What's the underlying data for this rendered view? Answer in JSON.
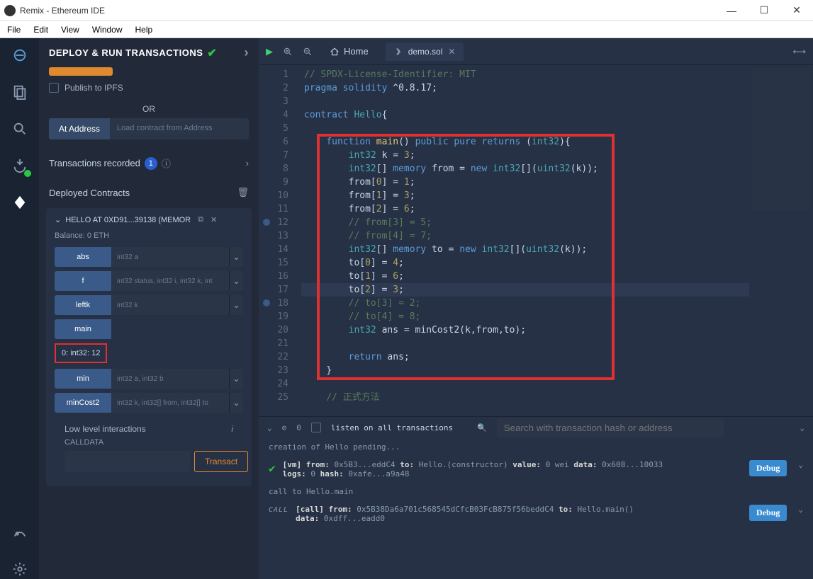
{
  "window": {
    "title": "Remix - Ethereum IDE"
  },
  "menubar": [
    "File",
    "Edit",
    "View",
    "Window",
    "Help"
  ],
  "panel": {
    "title": "DEPLOY & RUN TRANSACTIONS",
    "publish_label": "Publish to IPFS",
    "or": "OR",
    "at_address": "At Address",
    "addr_placeholder": "Load contract from Address",
    "tx_recorded": "Transactions recorded",
    "tx_count": "1",
    "deployed_label": "Deployed Contracts",
    "contract_name": "HELLO AT 0XD91...39138 (MEMOR",
    "balance": "Balance: 0 ETH",
    "functions": [
      {
        "name": "abs",
        "ph": "int32 a"
      },
      {
        "name": "f",
        "ph": "int32 status, int32 i, int32 k, int"
      },
      {
        "name": "leftk",
        "ph": "int32 k"
      },
      {
        "name": "main",
        "ph": ""
      },
      {
        "name": "min",
        "ph": "int32 a, int32 b"
      },
      {
        "name": "minCost2",
        "ph": "int32 k, int32[] from, int32[] to"
      }
    ],
    "main_result": "0: int32: 12",
    "low_level": "Low level interactions",
    "calldata": "CALLDATA",
    "transact": "Transact"
  },
  "tabs": {
    "home": "Home",
    "file": "demo.sol"
  },
  "code_lines": [
    {
      "n": 1,
      "html": "<span class='cm'>// SPDX-License-Identifier: MIT</span>"
    },
    {
      "n": 2,
      "html": "<span class='kw'>pragma</span> <span class='kw'>solidity</span> <span class='op'>^0.8.17;</span>"
    },
    {
      "n": 3,
      "html": ""
    },
    {
      "n": 4,
      "html": "<span class='kw'>contract</span> <span class='ty'>Hello</span>{"
    },
    {
      "n": 5,
      "html": ""
    },
    {
      "n": 6,
      "html": "    <span class='kw'>function</span> <span class='fn'>main</span>() <span class='kw'>public</span> <span class='kw'>pure</span> <span class='kw'>returns</span> (<span class='ty'>int32</span>){"
    },
    {
      "n": 7,
      "html": "        <span class='ty'>int32</span> k = <span class='nm'>3</span>;"
    },
    {
      "n": 8,
      "html": "        <span class='ty'>int32</span>[] <span class='kw'>memory</span> from = <span class='kw'>new</span> <span class='ty'>int32</span>[](<span class='ty'>uint32</span>(k));"
    },
    {
      "n": 9,
      "html": "        from[<span class='nm'>0</span>] = <span class='nm'>1</span>;"
    },
    {
      "n": 10,
      "html": "        from[<span class='nm'>1</span>] = <span class='nm'>3</span>;"
    },
    {
      "n": 11,
      "html": "        from[<span class='nm'>2</span>] = <span class='nm'>6</span>;"
    },
    {
      "n": 12,
      "html": "        <span class='cm'>// from[3] = 5;</span>",
      "bp": true
    },
    {
      "n": 13,
      "html": "        <span class='cm'>// from[4] = 7;</span>"
    },
    {
      "n": 14,
      "html": "        <span class='ty'>int32</span>[] <span class='kw'>memory</span> to = <span class='kw'>new</span> <span class='ty'>int32</span>[](<span class='ty'>uint32</span>(k));"
    },
    {
      "n": 15,
      "html": "        to[<span class='nm'>0</span>] = <span class='nm'>4</span>;"
    },
    {
      "n": 16,
      "html": "        to[<span class='nm'>1</span>] = <span class='nm'>6</span>;"
    },
    {
      "n": 17,
      "html": "        to[<span class='nm'>2</span>] = <span class='nm'>3</span>;",
      "hl": true
    },
    {
      "n": 18,
      "html": "        <span class='cm'>// to[3] = 2;</span>",
      "bp": true
    },
    {
      "n": 19,
      "html": "        <span class='cm'>// to[4] = 8;</span>"
    },
    {
      "n": 20,
      "html": "        <span class='ty'>int32</span> ans = minCost2(k,from,to);"
    },
    {
      "n": 21,
      "html": ""
    },
    {
      "n": 22,
      "html": "        <span class='kw'>return</span> ans;"
    },
    {
      "n": 23,
      "html": "    }"
    },
    {
      "n": 24,
      "html": ""
    },
    {
      "n": 25,
      "html": "    <span class='cm'>// 正式方法</span>"
    }
  ],
  "terminal": {
    "listen": "listen on all transactions",
    "count": "0",
    "search_ph": "Search with transaction hash or address",
    "line1": "creation of Hello pending...",
    "entry1": {
      "t1": "[vm]",
      "l1": "from:",
      "v1": "0x5B3...eddC4",
      "l2": "to:",
      "v2": "Hello.(constructor)",
      "l3": "value:",
      "v3": "0 wei",
      "l4": "data:",
      "v4": "0x608...10033",
      "l5": "logs:",
      "v5": "0",
      "l6": "hash:",
      "v6": "0xafe...a9a48"
    },
    "line2": "call to Hello.main",
    "entry2": {
      "t1": "[call]",
      "l1": "from:",
      "v1": "0x5B38Da6a701c568545dCfcB03FcB875f56beddC4",
      "l2": "to:",
      "v2": "Hello.main()",
      "l3": "data:",
      "v3": "0xdff...eadd0"
    },
    "debug": "Debug"
  }
}
